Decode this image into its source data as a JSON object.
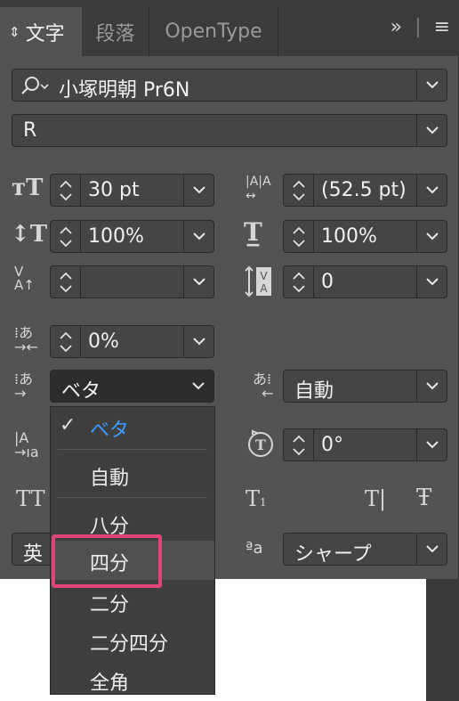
{
  "tabs": {
    "character": "文字",
    "paragraph": "段落",
    "opentype": "OpenType"
  },
  "tab_icons": {
    "expand": "»",
    "menu": "≡"
  },
  "font_family": "小塚明朝 Pr6N",
  "font_style": "R",
  "size": "30 pt",
  "leading": "(52.5 pt)",
  "vertical_scale": "100%",
  "horizontal_scale": "100%",
  "kerning": "",
  "tracking": "0",
  "tsume": "0%",
  "aki_left": "ベタ",
  "aki_right": "自動",
  "char_rotation": "0°",
  "language": "英",
  "antialias": "シャープ",
  "dropdown": {
    "checkmark": "✓",
    "items": [
      "ベタ",
      "自動",
      "八分",
      "四分",
      "二分",
      "二分四分",
      "全角"
    ]
  },
  "colors": {
    "selected_text": "#3d9bff",
    "highlight_frame": "#e0457b"
  }
}
